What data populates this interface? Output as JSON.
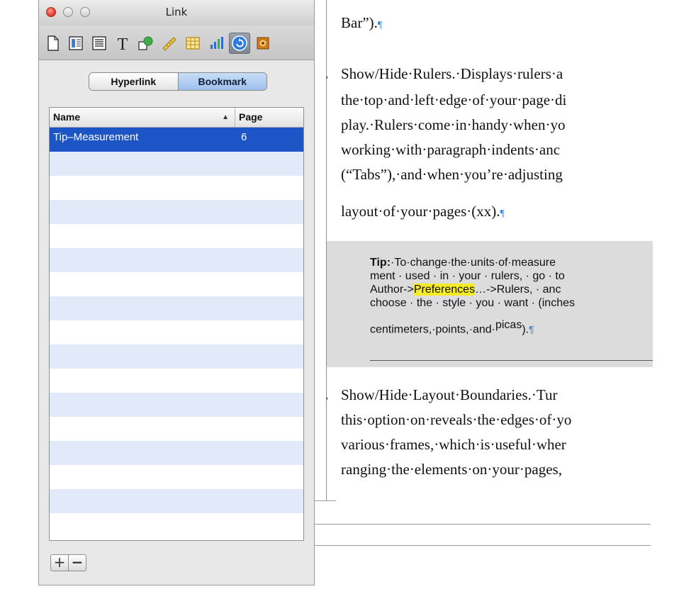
{
  "window": {
    "title": "Link"
  },
  "toolbar": {
    "icons": [
      "document-icon",
      "layout-icon",
      "wrap-icon",
      "text-icon",
      "graphic-icon",
      "metrics-icon",
      "table-icon",
      "chart-icon",
      "link-icon",
      "quicktime-icon"
    ],
    "active": "link-icon"
  },
  "segmented": {
    "hyperlink": "Hyperlink",
    "bookmark": "Bookmark",
    "selected": "Bookmark"
  },
  "table": {
    "col_name": "Name",
    "col_page": "Page",
    "sort_arrow": "▲",
    "rows": [
      {
        "name": "Tip–Measurement",
        "page": "6"
      }
    ]
  },
  "buttons": {
    "add": "+",
    "remove": "−"
  },
  "doc": {
    "para0_tail": "Bar”).",
    "para1": [
      "Show/Hide·Rulers.·Displays·rulers·a",
      "the·top·and·left·edge·of·your·page·di",
      "play.·Rulers·come·in·handy·when·yo",
      "working·with·paragraph·indents·anc",
      "(“Tabs”),·and·when·you’re·adjusting",
      "layout·of·your·pages·(xx)."
    ],
    "tip": {
      "label": "Tip:",
      "line1": "·To·change·the·units·of·measure",
      "line2": "ment · used · in · your · rulers, · go · to",
      "line3_pre": "Author->",
      "line3_hl": "Preferences",
      "line3_post": "…->Rulers, · anc",
      "line4": "choose · the · style · you · want · (inches",
      "line5_pre": "centimeters,·points,·and·",
      "line5_sup": "picas",
      "line5_post": ")."
    },
    "para2": [
      "Show/Hide·Layout·Boundaries.·Tur",
      "this·option·on·reveals·the·edges·of·yo",
      "various·frames,·which·is·useful·wher",
      "ranging·the·elements·on·your·pages,"
    ],
    "pilcrow": "¶"
  },
  "colors": {
    "selection": "#1d55c7",
    "alt_row": "#e2eaf9",
    "highlight": "#f5ec25",
    "pilcrow": "#3a7fd8"
  }
}
